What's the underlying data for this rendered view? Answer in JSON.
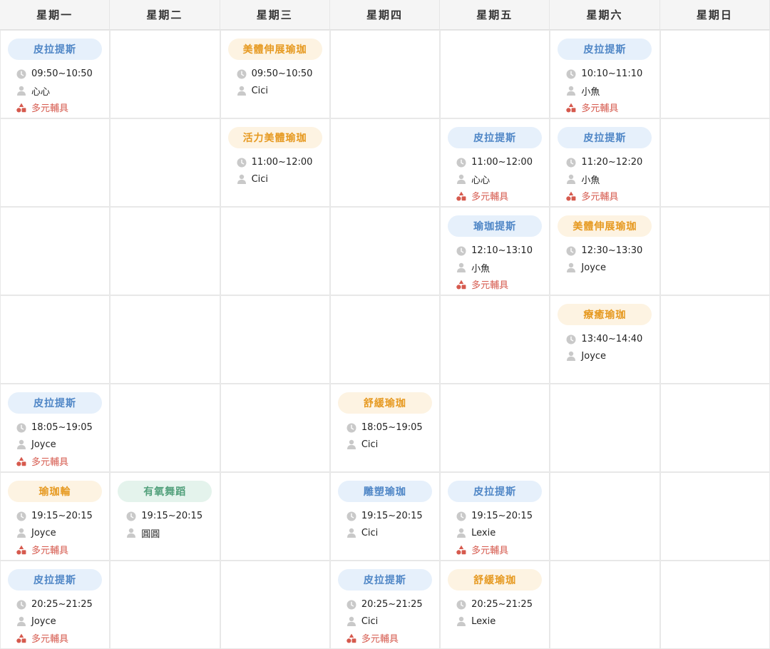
{
  "days": [
    "星期一",
    "星期二",
    "星期三",
    "星期四",
    "星期五",
    "星期六",
    "星期日"
  ],
  "colors": {
    "blue_pill_bg": "#e6f0fb",
    "blue_pill_text": "#4f86c6",
    "orange_pill_bg": "#fdf3e2",
    "orange_pill_text": "#e69a22",
    "green_pill_bg": "#e4f3ec",
    "green_pill_text": "#52a07b",
    "props_text": "#d65a4e"
  },
  "icons": {
    "time": "clock-icon",
    "teacher": "person-icon",
    "props": "shapes-icon"
  },
  "classes": [
    {
      "day": 0,
      "slot": 0,
      "name": "皮拉提斯",
      "color": "blue",
      "time": "09:50~10:50",
      "teacher": "心心",
      "props": "多元輔具"
    },
    {
      "day": 2,
      "slot": 0,
      "name": "美體伸展瑜珈",
      "color": "orange",
      "time": "09:50~10:50",
      "teacher": "Cici",
      "props": ""
    },
    {
      "day": 5,
      "slot": 0,
      "name": "皮拉提斯",
      "color": "blue",
      "time": "10:10~11:10",
      "teacher": "小魚",
      "props": "多元輔具"
    },
    {
      "day": 2,
      "slot": 1,
      "name": "活力美體瑜珈",
      "color": "orange",
      "time": "11:00~12:00",
      "teacher": "Cici",
      "props": ""
    },
    {
      "day": 4,
      "slot": 1,
      "name": "皮拉提斯",
      "color": "blue",
      "time": "11:00~12:00",
      "teacher": "心心",
      "props": "多元輔具"
    },
    {
      "day": 5,
      "slot": 1,
      "name": "皮拉提斯",
      "color": "blue",
      "time": "11:20~12:20",
      "teacher": "小魚",
      "props": "多元輔具"
    },
    {
      "day": 4,
      "slot": 2,
      "name": "瑜珈提斯",
      "color": "blue",
      "time": "12:10~13:10",
      "teacher": "小魚",
      "props": "多元輔具"
    },
    {
      "day": 5,
      "slot": 2,
      "name": "美體伸展瑜珈",
      "color": "orange",
      "time": "12:30~13:30",
      "teacher": "Joyce",
      "props": ""
    },
    {
      "day": 5,
      "slot": 3,
      "name": "療癒瑜珈",
      "color": "orange",
      "time": "13:40~14:40",
      "teacher": "Joyce",
      "props": ""
    },
    {
      "day": 0,
      "slot": 4,
      "name": "皮拉提斯",
      "color": "blue",
      "time": "18:05~19:05",
      "teacher": "Joyce",
      "props": "多元輔具"
    },
    {
      "day": 3,
      "slot": 4,
      "name": "舒緩瑜珈",
      "color": "orange",
      "time": "18:05~19:05",
      "teacher": "Cici",
      "props": ""
    },
    {
      "day": 0,
      "slot": 5,
      "name": "瑜珈輪",
      "color": "orange",
      "time": "19:15~20:15",
      "teacher": "Joyce",
      "props": "多元輔具"
    },
    {
      "day": 1,
      "slot": 5,
      "name": "有氧舞蹈",
      "color": "green",
      "time": "19:15~20:15",
      "teacher": "圓圓",
      "props": ""
    },
    {
      "day": 3,
      "slot": 5,
      "name": "雕塑瑜珈",
      "color": "blue",
      "time": "19:15~20:15",
      "teacher": "Cici",
      "props": ""
    },
    {
      "day": 4,
      "slot": 5,
      "name": "皮拉提斯",
      "color": "blue",
      "time": "19:15~20:15",
      "teacher": "Lexie",
      "props": "多元輔具"
    },
    {
      "day": 0,
      "slot": 6,
      "name": "皮拉提斯",
      "color": "blue",
      "time": "20:25~21:25",
      "teacher": "Joyce",
      "props": "多元輔具"
    },
    {
      "day": 3,
      "slot": 6,
      "name": "皮拉提斯",
      "color": "blue",
      "time": "20:25~21:25",
      "teacher": "Cici",
      "props": "多元輔具"
    },
    {
      "day": 4,
      "slot": 6,
      "name": "舒緩瑜珈",
      "color": "orange",
      "time": "20:25~21:25",
      "teacher": "Lexie",
      "props": ""
    }
  ]
}
